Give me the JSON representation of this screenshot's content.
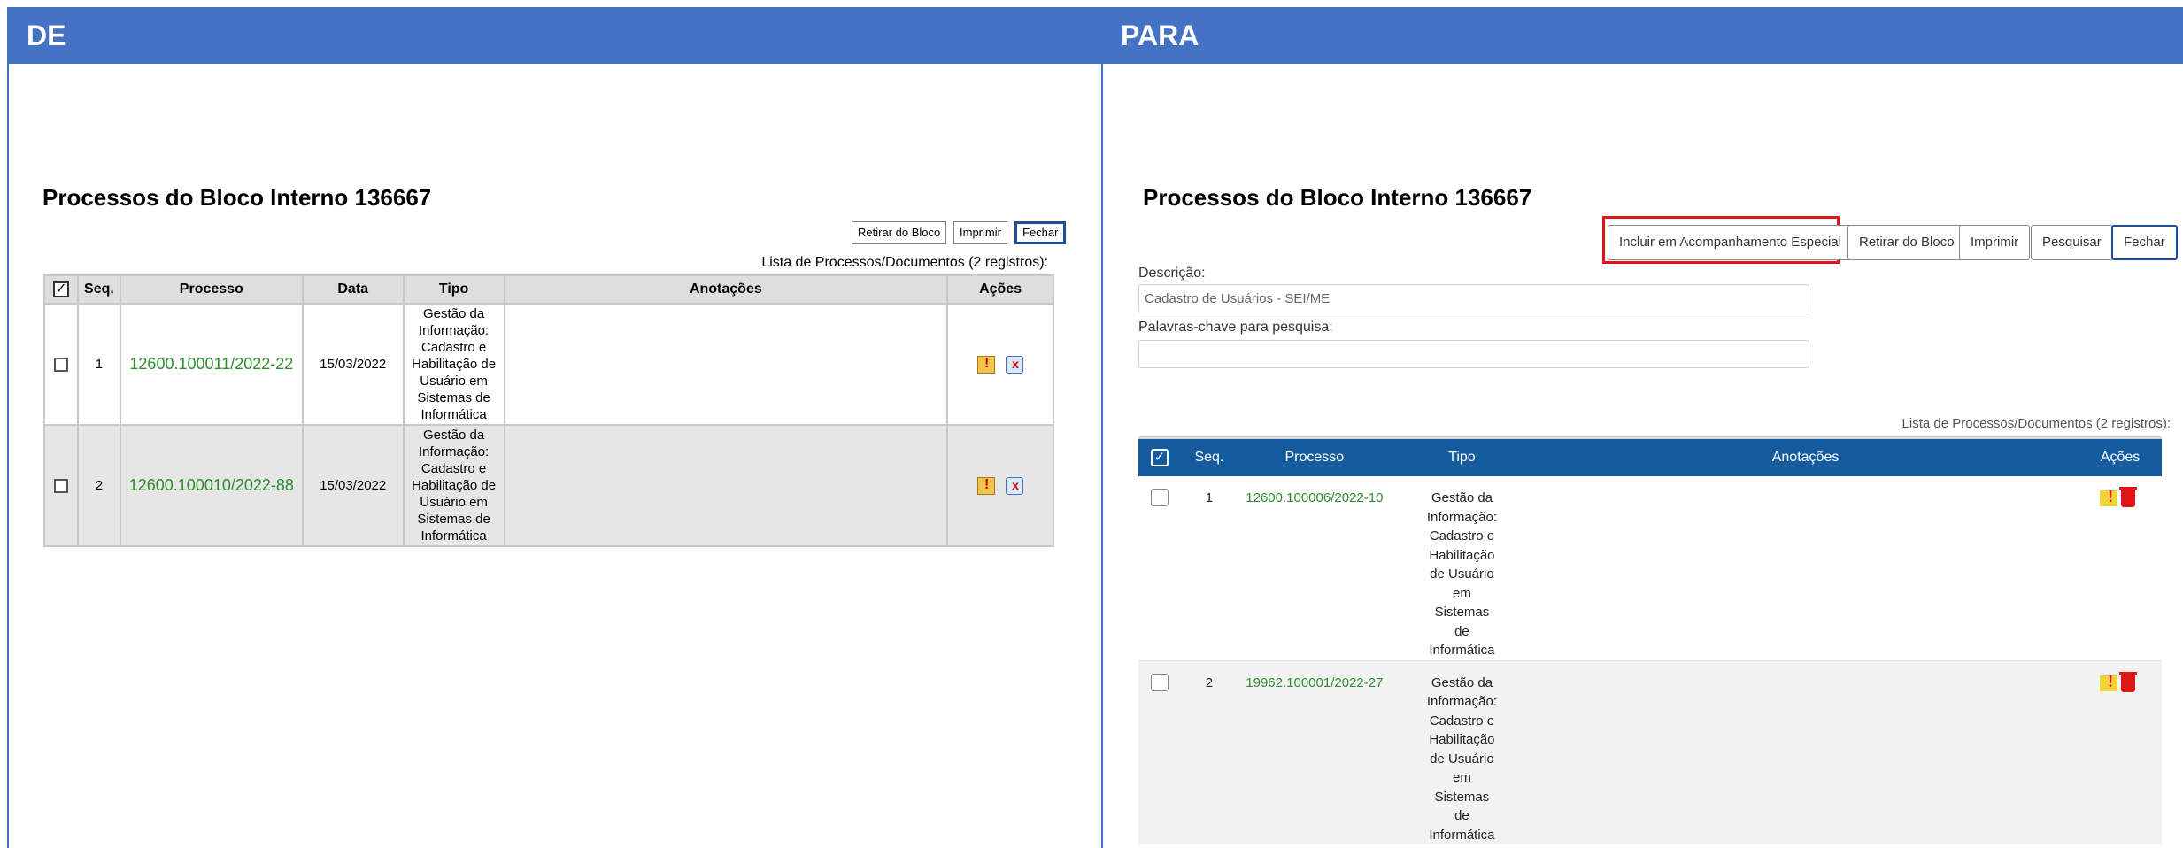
{
  "de": {
    "header": "DE",
    "title": "Processos do Bloco Interno 136667",
    "buttons": {
      "retirar": "Retirar do Bloco",
      "imprimir": "Imprimir",
      "fechar": "Fechar"
    },
    "caption": "Lista de Processos/Documentos (2 registros):",
    "columns": {
      "seq": "Seq.",
      "processo": "Processo",
      "data": "Data",
      "tipo": "Tipo",
      "anotacoes": "Anotações",
      "acoes": "Ações"
    },
    "rows": [
      {
        "seq": "1",
        "processo": "12600.100011/2022-22",
        "data": "15/03/2022",
        "tipo": "Gestão da Informação: Cadastro e Habilitação de Usuário em Sistemas de Informática",
        "anotacoes": ""
      },
      {
        "seq": "2",
        "processo": "12600.100010/2022-88",
        "data": "15/03/2022",
        "tipo": "Gestão da Informação: Cadastro e Habilitação de Usuário em Sistemas de Informática",
        "anotacoes": ""
      }
    ]
  },
  "para": {
    "header": "PARA",
    "title": "Processos do Bloco Interno 136667",
    "buttons": {
      "incluir": "Incluir em Acompanhamento Especial",
      "retirar": "Retirar do Bloco",
      "imprimir": "Imprimir",
      "pesquisar": "Pesquisar",
      "fechar": "Fechar"
    },
    "descricao_label": "Descrição:",
    "descricao_value": "Cadastro de Usuários - SEI/ME",
    "palavras_label": "Palavras-chave para pesquisa:",
    "palavras_value": "",
    "caption": "Lista de Processos/Documentos (2 registros):",
    "columns": {
      "seq": "Seq.",
      "processo": "Processo",
      "tipo": "Tipo",
      "anotacoes": "Anotações",
      "acoes": "Ações"
    },
    "rows": [
      {
        "seq": "1",
        "processo": "12600.100006/2022-10",
        "tipo": "Gestão da Informação: Cadastro e Habilitação de Usuário em Sistemas de Informática",
        "anotacoes": ""
      },
      {
        "seq": "2",
        "processo": "19962.100001/2022-27",
        "tipo": "Gestão da Informação: Cadastro e Habilitação de Usuário em Sistemas de Informática",
        "anotacoes": ""
      }
    ]
  },
  "colors": {
    "header_blue": "#4472c4",
    "table_header_blue": "#155b9e",
    "process_green": "#2e8b2e",
    "highlight_red": "#e01515"
  },
  "icons": {
    "anotacao": "annotation-icon",
    "retirar": "remove-from-block-icon",
    "excluir": "trash-icon"
  }
}
